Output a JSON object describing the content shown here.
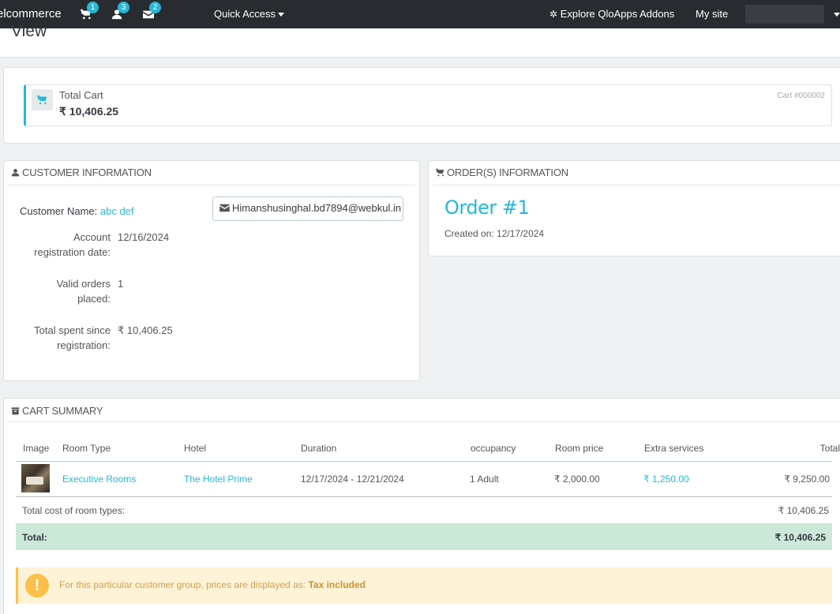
{
  "topbar": {
    "brand": "elcommerce",
    "orders_badge": "1",
    "customers_badge": "3",
    "messages_badge": "2",
    "quick_access": "Quick Access",
    "explore": "Explore QloApps Addons",
    "my_site": "My site"
  },
  "page": {
    "title": "View"
  },
  "kpi": {
    "title": "Total Cart",
    "value": "₹ 10,406.25",
    "ref": "Cart #000002"
  },
  "customer": {
    "header": "CUSTOMER INFORMATION",
    "name_label": "Customer Name:",
    "name": "abc def",
    "email": "Himanshusinghal.bd7894@webkul.in",
    "reg_label_1": "Account",
    "reg_label_2": "registration date:",
    "reg_value": "12/16/2024",
    "orders_label_1": "Valid orders",
    "orders_label_2": "placed:",
    "orders_value": "1",
    "spent_label_1": "Total spent since",
    "spent_label_2": "registration:",
    "spent_value": "₹ 10,406.25"
  },
  "orders": {
    "header": "ORDER(S) INFORMATION",
    "order_title": "Order #1",
    "created": "Created on: 12/17/2024"
  },
  "cart": {
    "header": "CART SUMMARY",
    "columns": [
      "Image",
      "Room Type",
      "Hotel",
      "Duration",
      "occupancy",
      "Room price",
      "Extra services",
      "Total"
    ],
    "row": {
      "room_type": "Executive Rooms",
      "hotel": "The Hotel Prime",
      "duration": "12/17/2024 - 12/21/2024",
      "occupancy": "1 Adult",
      "room_price": "₹ 2,000.00",
      "extra_services": "₹ 1,250.00",
      "total": "₹ 9,250.00"
    },
    "total_cost_label": "Total cost of room types:",
    "total_cost_value": "₹ 10,406.25",
    "total_label": "Total:",
    "total_value": "₹ 10,406.25",
    "notice_text": "For this particular customer group, prices are displayed as: ",
    "notice_bold": "Tax included"
  }
}
